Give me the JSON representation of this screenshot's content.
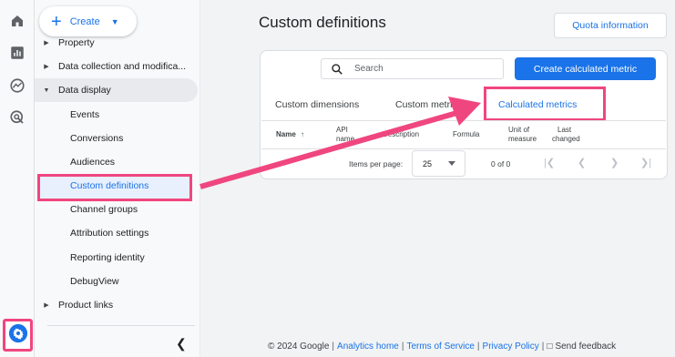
{
  "rail": {
    "icons": [
      "home-icon",
      "reports-icon",
      "explore-icon",
      "advertising-icon",
      "admin-gear-icon"
    ]
  },
  "nav": {
    "create_label": "Create",
    "items": [
      {
        "label": "Property",
        "expandable": true
      },
      {
        "label": "Data collection and modifica...",
        "expandable": true
      },
      {
        "label": "Data display",
        "expandable": true,
        "expanded": true
      }
    ],
    "sub_items": [
      "Events",
      "Conversions",
      "Audiences",
      "Custom definitions",
      "Channel groups",
      "Attribution settings",
      "Reporting identity",
      "DebugView"
    ],
    "selected_sub_item": "Custom definitions",
    "product_links": "Product links"
  },
  "main": {
    "title": "Custom definitions",
    "quota_button": "Quota information",
    "search_placeholder": "Search",
    "create_metric_button": "Create calculated metric",
    "tabs": [
      "Custom dimensions",
      "Custom metrics",
      "Calculated metrics"
    ],
    "active_tab": "Calculated metrics",
    "columns": {
      "name": "Name",
      "api_name_1": "API",
      "api_name_2": "name",
      "description": "Description",
      "formula": "Formula",
      "unit_1": "Unit of",
      "unit_2": "measure",
      "last_1": "Last",
      "last_2": "changed"
    },
    "sort_icon": "arrow-up-icon",
    "pager": {
      "label": "Items per page:",
      "per_page": "25",
      "count": "0 of 0"
    }
  },
  "footer": {
    "copyright": "© 2024 Google",
    "links": [
      "Analytics home",
      "Terms of Service",
      "Privacy Policy"
    ],
    "feedback": "Send feedback"
  },
  "colors": {
    "accent": "#1a73e8",
    "highlight": "#f0467f"
  }
}
